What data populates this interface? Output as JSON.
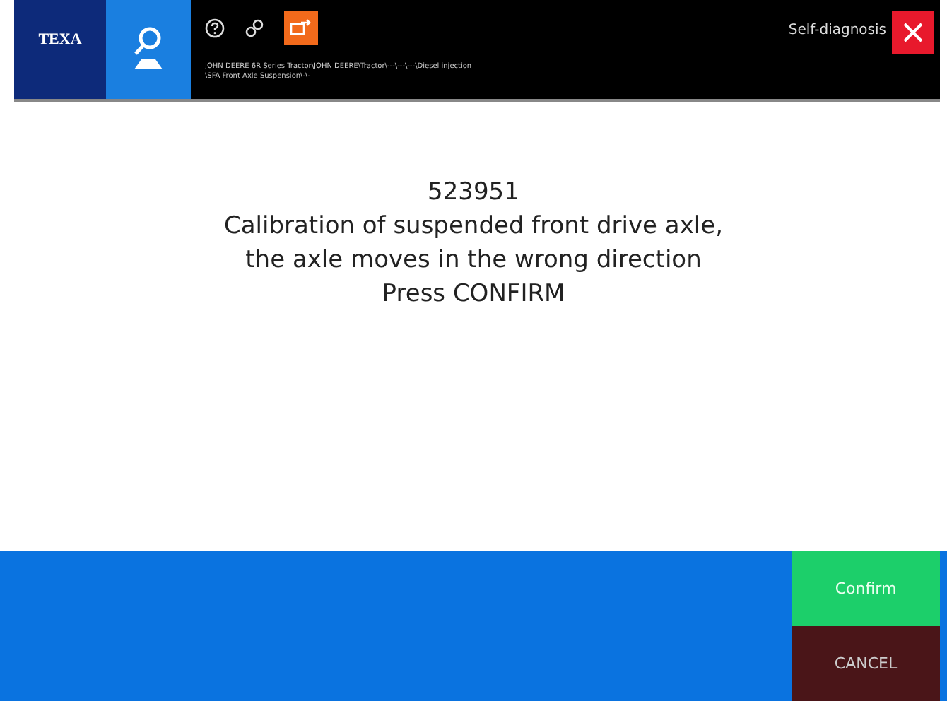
{
  "header": {
    "logo": "TEXA",
    "breadcrumb": [
      "JOHN DEERE 6R Series Tractor\\JOHN DEERE\\Tractor\\---\\---\\---\\Diesel injection",
      "\\SFA Front Axle Suspension\\-\\-"
    ],
    "title": "Self-diagnosis"
  },
  "message": [
    "523951",
    "Calibration of suspended front drive axle,",
    "the axle moves in the wrong direction",
    "Press CONFIRM"
  ],
  "buttons": [
    {
      "label": "Confirm",
      "kind": "confirm"
    },
    {
      "label": "CANCEL",
      "kind": "cancel"
    }
  ]
}
